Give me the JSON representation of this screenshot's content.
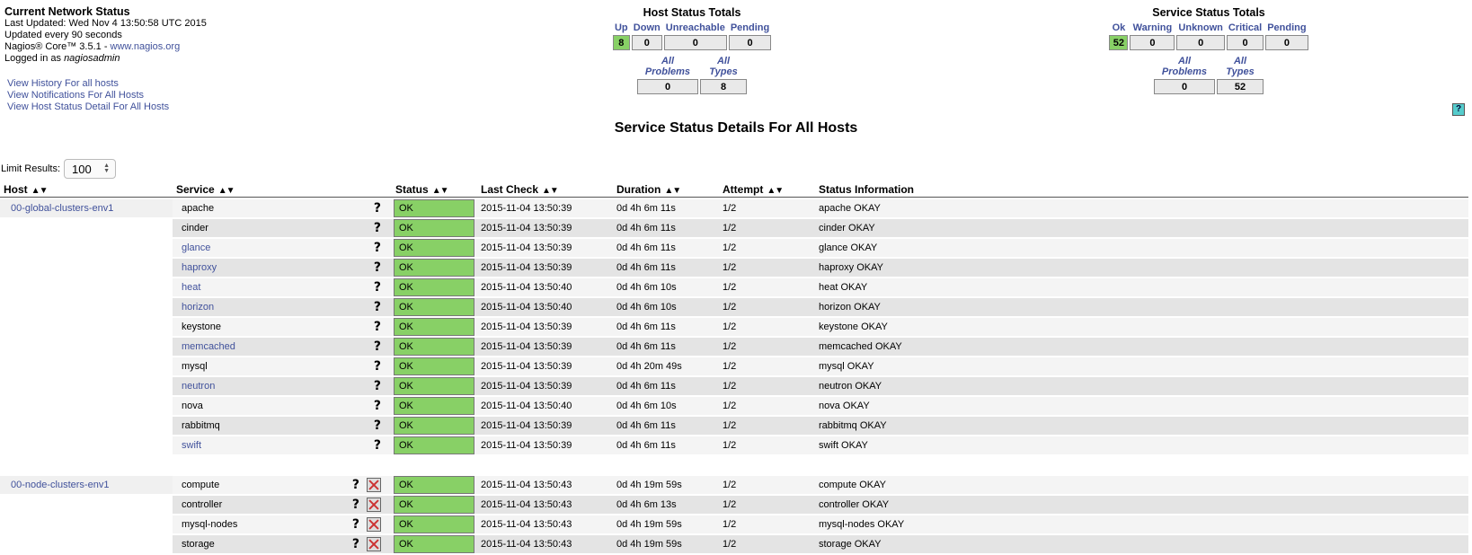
{
  "info": {
    "title": "Current Network Status",
    "last_updated": "Last Updated: Wed Nov 4 13:50:58 UTC 2015",
    "update_interval": "Updated every 90 seconds",
    "version_prefix": "Nagios® Core™ 3.5.1 - ",
    "version_link": "www.nagios.org",
    "logged_in_prefix": "Logged in as ",
    "user": "nagiosadmin"
  },
  "nav_links": [
    "View History For all hosts",
    "View Notifications For All Hosts",
    "View Host Status Detail For All Hosts"
  ],
  "host_totals": {
    "title": "Host Status Totals",
    "headers": [
      "Up",
      "Down",
      "Unreachable",
      "Pending"
    ],
    "values": [
      "8",
      "0",
      "0",
      "0"
    ],
    "sub_headers": [
      "All Problems",
      "All Types"
    ],
    "sub_values": [
      "0",
      "8"
    ]
  },
  "service_totals": {
    "title": "Service Status Totals",
    "headers": [
      "Ok",
      "Warning",
      "Unknown",
      "Critical",
      "Pending"
    ],
    "values": [
      "52",
      "0",
      "0",
      "0",
      "0"
    ],
    "sub_headers": [
      "All Problems",
      "All Types"
    ],
    "sub_values": [
      "0",
      "52"
    ]
  },
  "page_title": "Service Status Details For All Hosts",
  "limit": {
    "label": "Limit Results:",
    "value": "100"
  },
  "columns": [
    "Host",
    "Service",
    "Status",
    "Last Check",
    "Duration",
    "Attempt",
    "Status Information"
  ],
  "help_icon": "?",
  "groups": [
    {
      "host": "00-global-clusters-env1",
      "show_x_icon": false,
      "rows": [
        {
          "service": "apache",
          "link": false,
          "status": "OK",
          "last_check": "2015-11-04 13:50:39",
          "duration": "0d 4h 6m 11s",
          "attempt": "1/2",
          "info": "apache OKAY"
        },
        {
          "service": "cinder",
          "link": false,
          "status": "OK",
          "last_check": "2015-11-04 13:50:39",
          "duration": "0d 4h 6m 11s",
          "attempt": "1/2",
          "info": "cinder OKAY"
        },
        {
          "service": "glance",
          "link": true,
          "status": "OK",
          "last_check": "2015-11-04 13:50:39",
          "duration": "0d 4h 6m 11s",
          "attempt": "1/2",
          "info": "glance OKAY"
        },
        {
          "service": "haproxy",
          "link": true,
          "status": "OK",
          "last_check": "2015-11-04 13:50:39",
          "duration": "0d 4h 6m 11s",
          "attempt": "1/2",
          "info": "haproxy OKAY"
        },
        {
          "service": "heat",
          "link": true,
          "status": "OK",
          "last_check": "2015-11-04 13:50:40",
          "duration": "0d 4h 6m 10s",
          "attempt": "1/2",
          "info": "heat OKAY"
        },
        {
          "service": "horizon",
          "link": true,
          "status": "OK",
          "last_check": "2015-11-04 13:50:40",
          "duration": "0d 4h 6m 10s",
          "attempt": "1/2",
          "info": "horizon OKAY"
        },
        {
          "service": "keystone",
          "link": false,
          "status": "OK",
          "last_check": "2015-11-04 13:50:39",
          "duration": "0d 4h 6m 11s",
          "attempt": "1/2",
          "info": "keystone OKAY"
        },
        {
          "service": "memcached",
          "link": true,
          "status": "OK",
          "last_check": "2015-11-04 13:50:39",
          "duration": "0d 4h 6m 11s",
          "attempt": "1/2",
          "info": "memcached OKAY"
        },
        {
          "service": "mysql",
          "link": false,
          "status": "OK",
          "last_check": "2015-11-04 13:50:39",
          "duration": "0d 4h 20m 49s",
          "attempt": "1/2",
          "info": "mysql OKAY"
        },
        {
          "service": "neutron",
          "link": true,
          "status": "OK",
          "last_check": "2015-11-04 13:50:39",
          "duration": "0d 4h 6m 11s",
          "attempt": "1/2",
          "info": "neutron OKAY"
        },
        {
          "service": "nova",
          "link": false,
          "status": "OK",
          "last_check": "2015-11-04 13:50:40",
          "duration": "0d 4h 6m 10s",
          "attempt": "1/2",
          "info": "nova OKAY"
        },
        {
          "service": "rabbitmq",
          "link": false,
          "status": "OK",
          "last_check": "2015-11-04 13:50:39",
          "duration": "0d 4h 6m 11s",
          "attempt": "1/2",
          "info": "rabbitmq OKAY"
        },
        {
          "service": "swift",
          "link": true,
          "status": "OK",
          "last_check": "2015-11-04 13:50:39",
          "duration": "0d 4h 6m 11s",
          "attempt": "1/2",
          "info": "swift OKAY"
        }
      ]
    },
    {
      "host": "00-node-clusters-env1",
      "show_x_icon": true,
      "rows": [
        {
          "service": "compute",
          "link": false,
          "status": "OK",
          "last_check": "2015-11-04 13:50:43",
          "duration": "0d 4h 19m 59s",
          "attempt": "1/2",
          "info": "compute OKAY"
        },
        {
          "service": "controller",
          "link": false,
          "status": "OK",
          "last_check": "2015-11-04 13:50:43",
          "duration": "0d 4h 6m 13s",
          "attempt": "1/2",
          "info": "controller OKAY"
        },
        {
          "service": "mysql-nodes",
          "link": false,
          "status": "OK",
          "last_check": "2015-11-04 13:50:43",
          "duration": "0d 4h 19m 59s",
          "attempt": "1/2",
          "info": "mysql-nodes OKAY"
        },
        {
          "service": "storage",
          "link": false,
          "status": "OK",
          "last_check": "2015-11-04 13:50:43",
          "duration": "0d 4h 19m 59s",
          "attempt": "1/2",
          "info": "storage OKAY"
        }
      ]
    }
  ]
}
